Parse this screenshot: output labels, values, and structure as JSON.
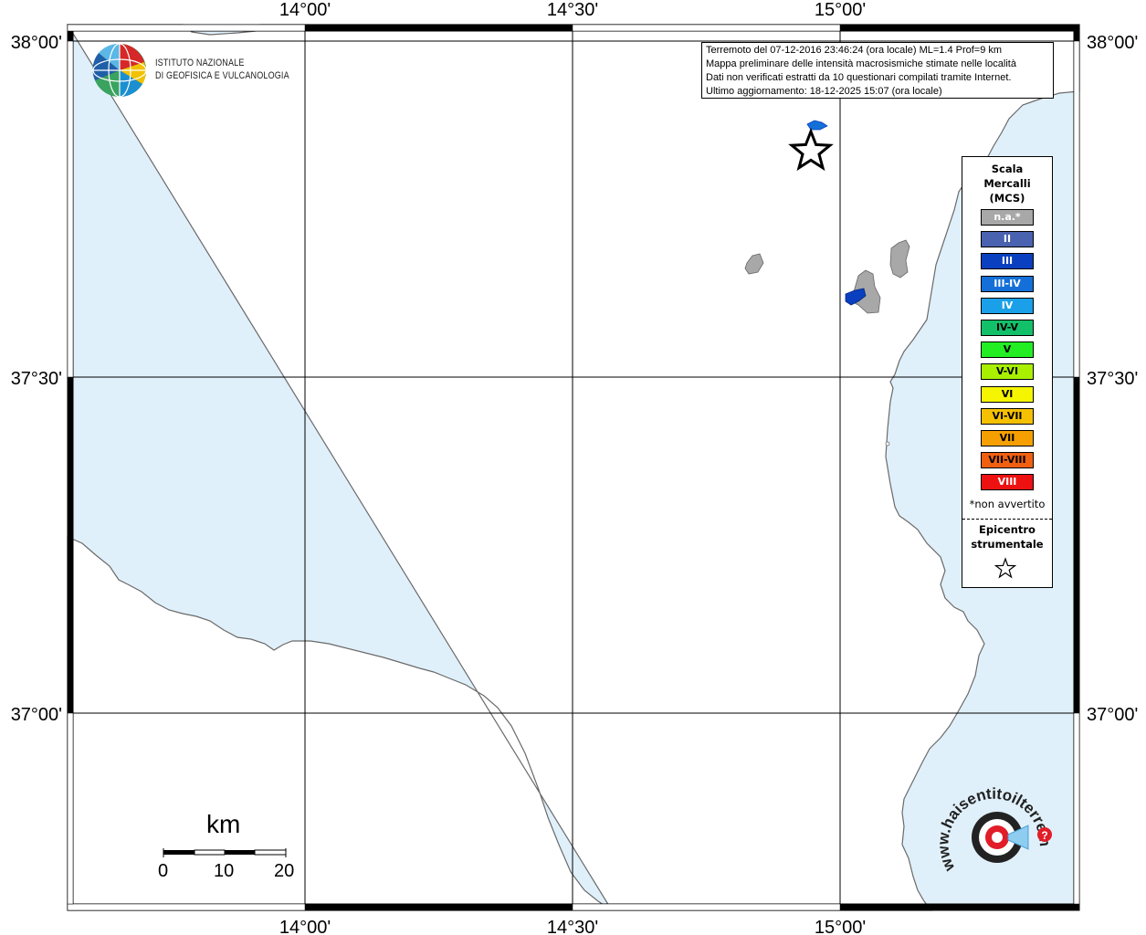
{
  "map": {
    "colors": {
      "sea": "#e0f0fa",
      "land": "#ffffff",
      "coast": "#6a6a6a",
      "grid": "#000000",
      "locality_gray": "#a8a8a8",
      "locality_blue": "#0a3fbf",
      "locality_lightblue": "#1470d8"
    },
    "lon_labels_top": [
      "14°00'",
      "14°30'",
      "15°00'"
    ],
    "lon_labels_bottom": [
      "14°00'",
      "14°30'",
      "15°00'"
    ],
    "lat_labels_left": [
      "38°00'",
      "37°30'",
      "37°00'"
    ],
    "lat_labels_right": [
      "38°00'",
      "37°30'",
      "37°00'"
    ],
    "epicenter_symbol": "star-icon"
  },
  "ingv_logo": {
    "line1": "ISTITUTO NAZIONALE",
    "line2": "DI GEOFISICA E VULCANOLOGIA"
  },
  "info_box": {
    "line1": "Terremoto del 07-12-2016 23:46:24 (ora locale) ML=1.4 Prof=9 km",
    "line2": "Mappa preliminare delle intensità macrosismiche stimate nelle località",
    "line3": "Dati non verificati estratti da 10 questionari compilati tramite Internet.",
    "line4": "Ultimo aggiornamento: 18-12-2025 15:07 (ora locale)"
  },
  "legend": {
    "title_1": "Scala",
    "title_2": "Mercalli",
    "title_3": "(MCS)",
    "items": [
      {
        "label": "n.a.*",
        "color": "#a8a8a8",
        "text_color": "#ffffff"
      },
      {
        "label": "II",
        "color": "#4a63b0",
        "text_color": "#ffffff"
      },
      {
        "label": "III",
        "color": "#0a3fbf",
        "text_color": "#ffffff"
      },
      {
        "label": "III-IV",
        "color": "#1470d8",
        "text_color": "#ffffff"
      },
      {
        "label": "IV",
        "color": "#1aa0e8",
        "text_color": "#ffffff"
      },
      {
        "label": "IV-V",
        "color": "#12c06a",
        "text_color": "#000000"
      },
      {
        "label": "V",
        "color": "#22ee22",
        "text_color": "#000000"
      },
      {
        "label": "V-VI",
        "color": "#a8f000",
        "text_color": "#000000"
      },
      {
        "label": "VI",
        "color": "#f5f500",
        "text_color": "#000000"
      },
      {
        "label": "VI-VII",
        "color": "#f5c000",
        "text_color": "#000000"
      },
      {
        "label": "VII",
        "color": "#f5a000",
        "text_color": "#000000"
      },
      {
        "label": "VII-VIII",
        "color": "#f06010",
        "text_color": "#000000"
      },
      {
        "label": "VIII",
        "color": "#ee1111",
        "text_color": "#ffffff"
      }
    ],
    "note": "*non avvertito",
    "epicenter_1": "Epicentro",
    "epicenter_2": "strumentale"
  },
  "scale_bar": {
    "unit": "km",
    "labels": [
      "0",
      "10",
      "20"
    ]
  },
  "hst_logo": {
    "text": "www.haisentitoilterremoto.it"
  }
}
